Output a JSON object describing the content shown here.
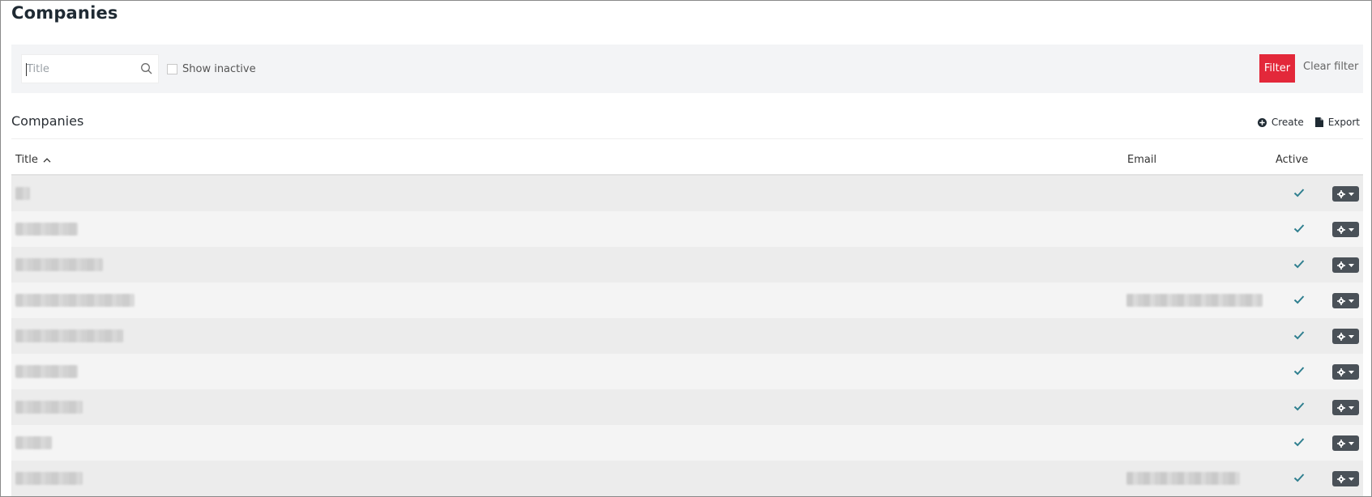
{
  "page": {
    "title": "Companies"
  },
  "filters": {
    "search_placeholder": "Title",
    "search_value": "",
    "show_inactive_label": "Show inactive",
    "show_inactive_checked": false,
    "filter_button": "Filter",
    "clear_filter_button": "Clear filter",
    "filter_color": "#e3283a"
  },
  "section": {
    "title": "Companies",
    "actions": [
      {
        "label": "Create",
        "icon": "plus-circle-icon"
      },
      {
        "label": "Export",
        "icon": "file-icon"
      }
    ]
  },
  "table": {
    "columns": [
      {
        "label": "Title",
        "sort": "ascending"
      },
      {
        "label": "Email"
      },
      {
        "label": "Active"
      }
    ],
    "rows": [
      {
        "title_blur_width": 0.011,
        "email": "",
        "active": true
      },
      {
        "title_blur_width": 0.046,
        "email": "",
        "active": true
      },
      {
        "title_blur_width": 0.065,
        "email": "",
        "active": true
      },
      {
        "title_blur_width": 0.088,
        "email": "redacted",
        "active": true
      },
      {
        "title_blur_width": 0.08,
        "email": "",
        "active": true
      },
      {
        "title_blur_width": 0.046,
        "email": "",
        "active": true
      },
      {
        "title_blur_width": 0.05,
        "email": "",
        "active": true
      },
      {
        "title_blur_width": 0.027,
        "email": "",
        "active": true
      },
      {
        "title_blur_width": 0.05,
        "email": "redacted",
        "active": true
      }
    ],
    "check_color": "#2f7f8f",
    "row_action_icon": "gear-icon"
  }
}
